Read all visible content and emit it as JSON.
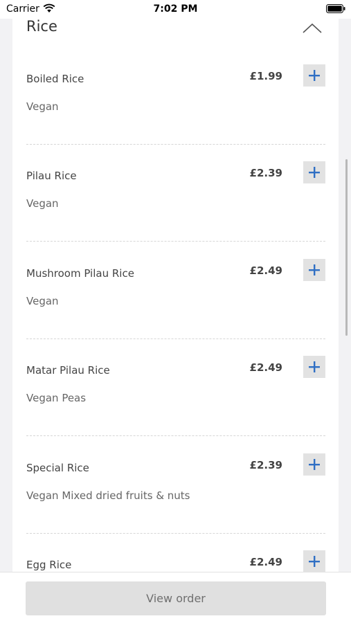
{
  "status_bar": {
    "carrier": "Carrier",
    "time": "7:02 PM",
    "icons": [
      "wifi-icon",
      "battery-icon"
    ]
  },
  "section": {
    "title": "Rice",
    "toggle_icon": "chevron-up-icon"
  },
  "items": [
    {
      "name": "Boiled Rice",
      "price": "£1.99",
      "description": "Vegan"
    },
    {
      "name": "Pilau Rice",
      "price": "£2.39",
      "description": "Vegan"
    },
    {
      "name": "Mushroom Pilau Rice",
      "price": "£2.49",
      "description": "Vegan"
    },
    {
      "name": "Matar Pilau Rice",
      "price": "£2.49",
      "description": "Vegan Peas"
    },
    {
      "name": "Special Rice",
      "price": "£2.39",
      "description": "Vegan Mixed dried fruits & nuts"
    },
    {
      "name": "Egg Rice",
      "price": "£2.49",
      "description": ""
    }
  ],
  "add_icon": "plus-icon",
  "footer": {
    "view_order_label": "View order"
  },
  "colors": {
    "accent": "#2f6fc4",
    "button_bg": "#e2e2e2",
    "text": "#444444"
  }
}
